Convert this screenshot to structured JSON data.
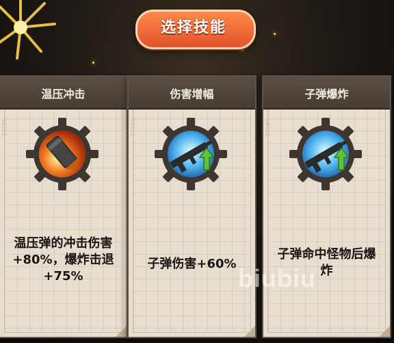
{
  "header": {
    "title": "选择技能"
  },
  "card_tag": "SKILL",
  "cards": [
    {
      "title": "温压冲击",
      "icon": "thermobaric-shell-icon",
      "desc_lines": [
        "温压弹的冲击伤害",
        "+80%，爆炸击退",
        "+75%"
      ]
    },
    {
      "title": "伤害增幅",
      "icon": "rifle-upgrade-icon",
      "desc_lines": [
        "子弹伤害+60%"
      ]
    },
    {
      "title": "子弹爆炸",
      "icon": "rifle-upgrade-icon",
      "desc_lines": [
        "子弹命中怪物后爆",
        "炸"
      ]
    }
  ],
  "watermark": "biubiu",
  "colors": {
    "title_badge": "#e0532b",
    "card_header": "#4f443c",
    "gear": "#3e3631",
    "accent_gold": "#ffd34a"
  }
}
